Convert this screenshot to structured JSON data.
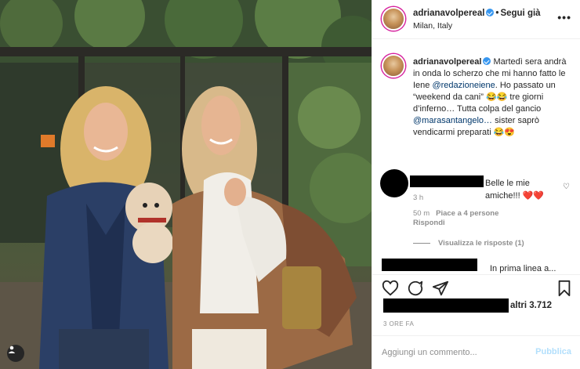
{
  "post": {
    "username": "adrianavolpereal",
    "follow_status": "Segui già",
    "location": "Milan, Italy",
    "more": "•••"
  },
  "caption": {
    "username": "adrianavolpereal",
    "text_1": "Martedì sera andrà in onda lo scherzo che mi hanno fatto le Iene ",
    "mention_1": "@redazioneiene",
    "text_2": ". Ho passato un “weekend da cani” 😂😂 tre giorni d’inferno… Tutta colpa del gancio ",
    "mention_2": "@marasantangelo…",
    "text_3": " sister saprò vendicarmi preparati 😂😍",
    "time": "3 h"
  },
  "comment": {
    "text": "Belle le mie amiche!!! ❤️❤️",
    "time": "50 m",
    "likes": "Piace a 4 persone",
    "reply": "Rispondi",
    "view_replies": "Visualizza le risposte (1)"
  },
  "next_comment": {
    "text_visible": "In prima linea a..."
  },
  "likes": {
    "text": "altri 3.712"
  },
  "date": "3 ORE FA",
  "composer": {
    "placeholder": "Aggiungi un commento...",
    "publish": "Pubblica"
  },
  "icons": [
    "heart-icon",
    "comment-icon",
    "share-icon",
    "bookmark-icon",
    "user-tag-icon",
    "verified-icon",
    "more-icon"
  ]
}
